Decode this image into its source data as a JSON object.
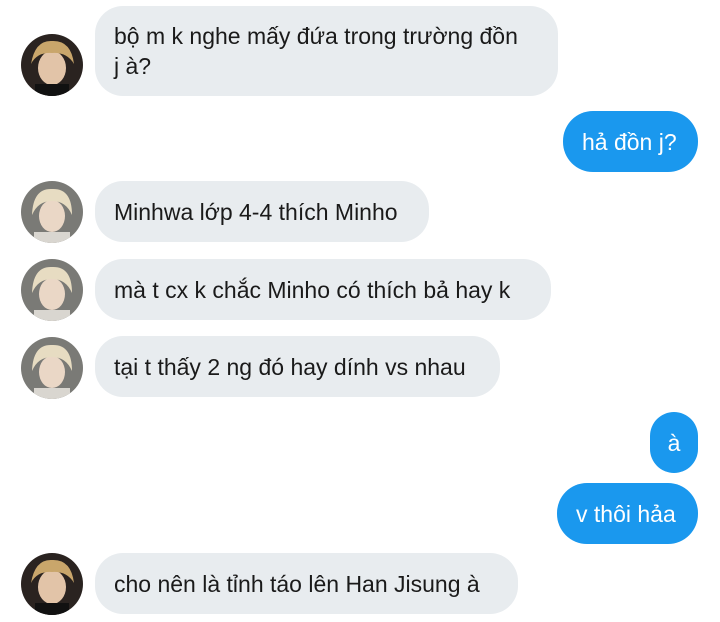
{
  "conversation": {
    "messages": [
      {
        "side": "incoming",
        "avatar": "avatar-dark-hair",
        "text": "bộ m k nghe mấy đứa trong trường đồn\nj à?"
      },
      {
        "side": "outgoing",
        "text": "hả đồn j?"
      },
      {
        "side": "incoming",
        "avatar": "avatar-blonde-hair",
        "text": "Minhwa lớp 4-4 thích Minho"
      },
      {
        "side": "incoming",
        "avatar": "avatar-blonde-hair",
        "text": "mà t cx k chắc Minho có thích bả hay k"
      },
      {
        "side": "incoming",
        "avatar": "avatar-blonde-hair",
        "text": "tại t thấy 2 ng đó hay dính vs nhau"
      },
      {
        "side": "outgoing",
        "text": "à"
      },
      {
        "side": "outgoing",
        "text": "v thôi hảa"
      },
      {
        "side": "incoming",
        "avatar": "avatar-dark-hair",
        "text": "cho nên là tỉnh táo lên Han Jisung à"
      }
    ]
  },
  "colors": {
    "incoming_bubble": "#e8ecef",
    "outgoing_bubble": "#1a98ee",
    "background": "#ffffff"
  }
}
